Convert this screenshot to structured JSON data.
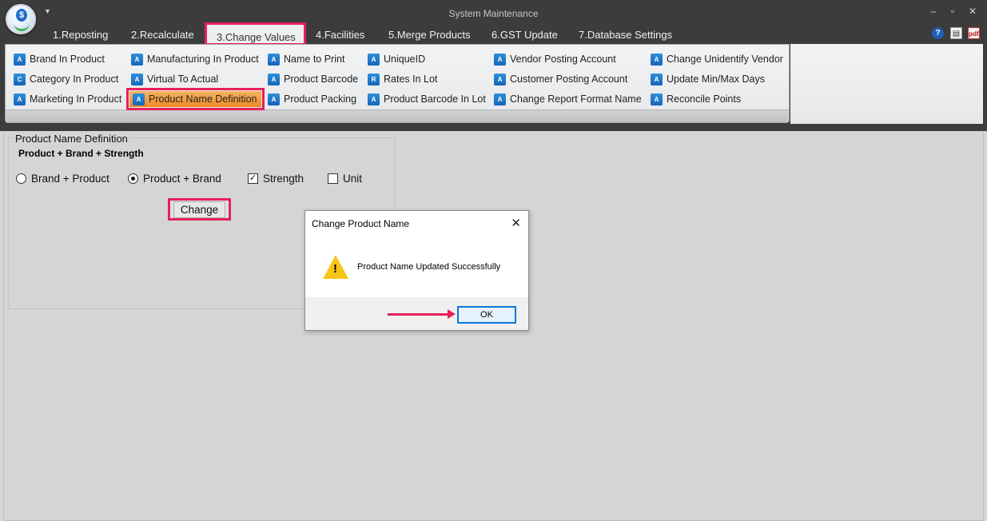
{
  "window": {
    "title": "System Maintenance",
    "controls": [
      "–",
      "▫",
      "✕"
    ]
  },
  "logo": {
    "glyph": "$"
  },
  "tabs": [
    {
      "label": "1.Reposting"
    },
    {
      "label": "2.Recalculate"
    },
    {
      "label": "3.Change Values"
    },
    {
      "label": "4.Facilities"
    },
    {
      "label": "5.Merge Products"
    },
    {
      "label": "6.GST Update"
    },
    {
      "label": "7.Database Settings"
    }
  ],
  "active_tab": "3.Change Values",
  "header_icons": {
    "help": "?",
    "pdf": "pdf"
  },
  "ribbon": {
    "items": [
      {
        "label": "Brand In Product"
      },
      {
        "label": "Category In Product"
      },
      {
        "label": "Marketing In Product"
      },
      {
        "label": "Manufacturing In Product"
      },
      {
        "label": "Virtual To Actual"
      },
      {
        "label": "Product Name Definition"
      },
      {
        "label": "Name to Print"
      },
      {
        "label": "Product Barcode"
      },
      {
        "label": "Product Packing"
      },
      {
        "label": "UniqueID"
      },
      {
        "label": "Rates In Lot"
      },
      {
        "label": "Product Barcode In Lot"
      },
      {
        "label": "Vendor Posting Account"
      },
      {
        "label": "Customer Posting Account"
      },
      {
        "label": "Change Report Format Name"
      },
      {
        "label": "Change Unidentify Vendor"
      },
      {
        "label": "Update Min/Max Days"
      },
      {
        "label": "Reconcile Points"
      }
    ],
    "selected": "Product Name Definition"
  },
  "form": {
    "group_title": "Product Name Definition",
    "formula": "Product + Brand + Strength",
    "options": {
      "brand_product": {
        "label": "Brand + Product",
        "selected": false
      },
      "product_brand": {
        "label": "Product + Brand",
        "selected": true
      },
      "strength": {
        "label": "Strength",
        "checked": true
      },
      "unit": {
        "label": "Unit",
        "checked": false
      }
    },
    "change_button": "Change"
  },
  "dialog": {
    "title": "Change Product Name",
    "message": "Product Name Updated Successfully",
    "ok_label": "OK",
    "icon": "warning-icon"
  },
  "colors": {
    "highlight": "#e8205a",
    "dark_chrome": "#3c3c3c",
    "selected_item": "#ef8a26",
    "icon_blue": "#1565b8"
  }
}
